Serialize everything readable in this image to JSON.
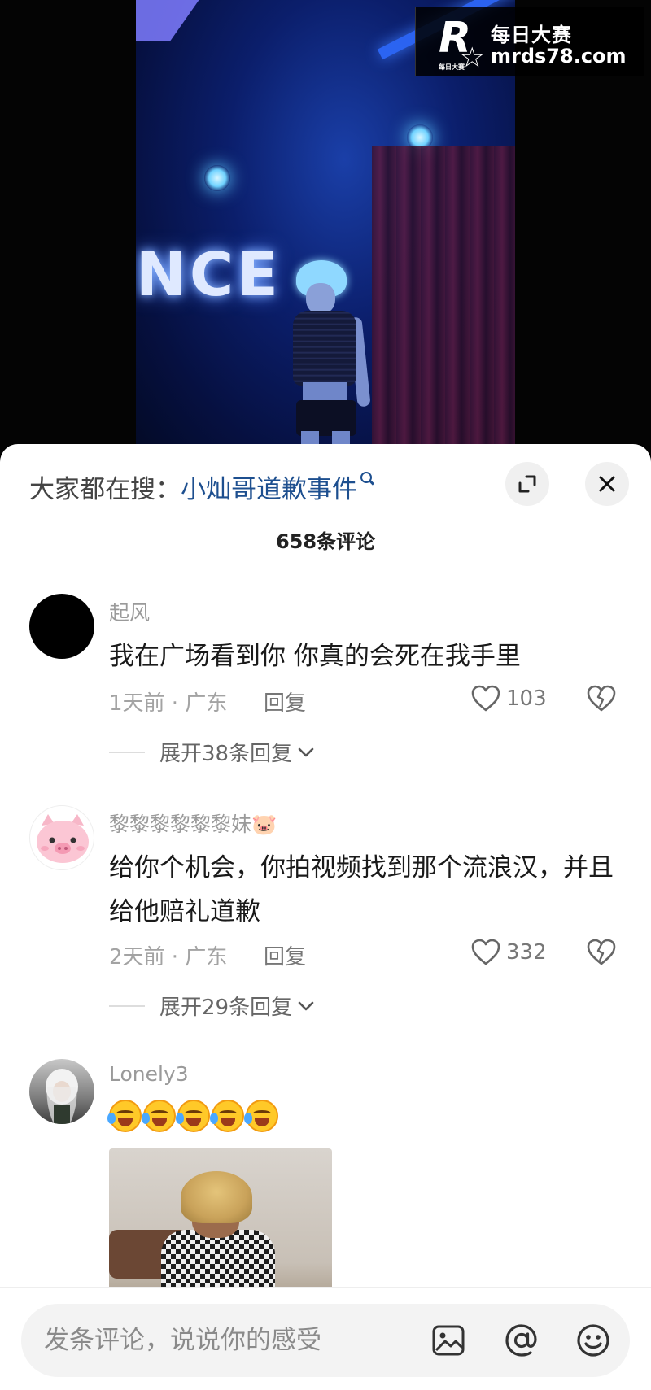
{
  "watermark": {
    "logo_letter": "R",
    "logo_small_text": "每日大赛",
    "site_name": "每日大赛",
    "url": "mrds78.com"
  },
  "video": {
    "sign_text": "NCE"
  },
  "header": {
    "search_prefix": "大家都在搜：",
    "search_term": "小灿哥道歉事件",
    "comment_count": "658条评论"
  },
  "comments": [
    {
      "username": "起风",
      "text": "我在广场看到你 你真的会死在我手里",
      "meta": "1天前 · 广东",
      "reply_label": "回复",
      "likes": "103",
      "expand_label": "展开38条回复"
    },
    {
      "username": "黎黎黎黎黎黎妹🐷",
      "text": "给你个机会，你拍视频找到那个流浪汉，并且给他赔礼道歉",
      "meta": "2天前 · 广东",
      "reply_label": "回复",
      "likes": "332",
      "expand_label": "展开29条回复"
    },
    {
      "username": "Lonely3",
      "emoji_count": 5
    }
  ],
  "input": {
    "placeholder": "发条评论，说说你的感受"
  },
  "icons": [
    "search-icon",
    "expand-icon",
    "close-icon",
    "heart-icon",
    "broken-heart-icon",
    "chevron-down-icon",
    "image-icon",
    "at-icon",
    "emoji-icon"
  ],
  "colors": {
    "accent_link": "#1d4f8f",
    "sheet_bg": "#ffffff",
    "video_blue": "#0b1e6b"
  }
}
